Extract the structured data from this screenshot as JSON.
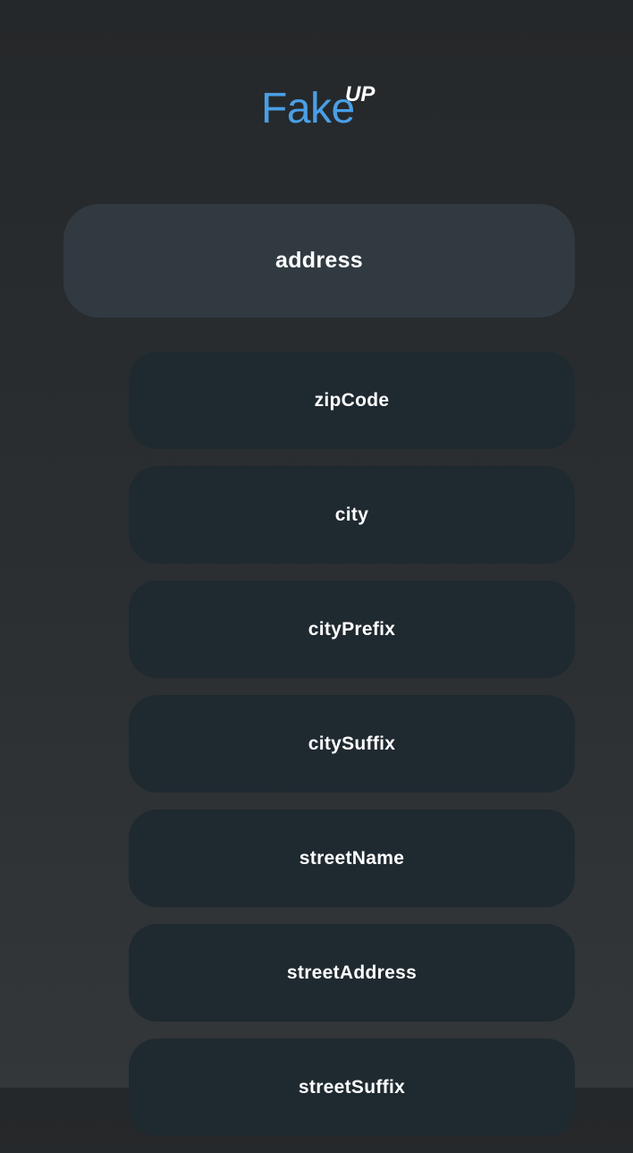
{
  "logo": {
    "main": "Fake",
    "superscript": "UP"
  },
  "category": {
    "label": "address"
  },
  "items": [
    {
      "label": "zipCode"
    },
    {
      "label": "city"
    },
    {
      "label": "cityPrefix"
    },
    {
      "label": "citySuffix"
    },
    {
      "label": "streetName"
    },
    {
      "label": "streetAddress"
    },
    {
      "label": "streetSuffix"
    }
  ],
  "colors": {
    "logo_accent": "#4a9fe6",
    "category_bg": "#313a41",
    "item_bg": "#1f2930",
    "text": "#ffffff"
  }
}
